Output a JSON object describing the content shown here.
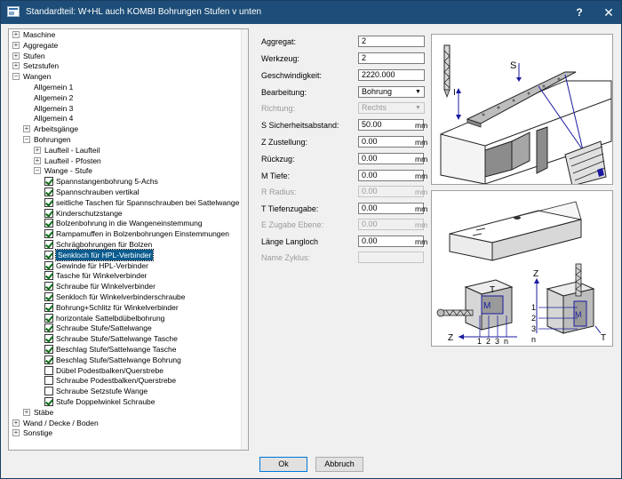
{
  "window": {
    "title": "Standardteil: W+HL auch KOMBI Bohrungen Stufen v unten",
    "help_label": "?",
    "close_label": "✕"
  },
  "tree": {
    "items": [
      {
        "label": "Maschine",
        "state": "collapsed"
      },
      {
        "label": "Aggregate",
        "state": "collapsed"
      },
      {
        "label": "Stufen",
        "state": "collapsed"
      },
      {
        "label": "Setzstufen",
        "state": "collapsed"
      },
      {
        "label": "Wangen",
        "state": "expanded"
      },
      {
        "label": "Allgemein  1"
      },
      {
        "label": "Allgemein  2"
      },
      {
        "label": "Allgemein  3"
      },
      {
        "label": "Allgemein  4"
      },
      {
        "label": "Arbeitsgänge",
        "state": "collapsed"
      },
      {
        "label": "Bohrungen",
        "state": "expanded"
      },
      {
        "label": "Laufteil - Laufteil",
        "state": "collapsed"
      },
      {
        "label": "Laufteil - Pfosten",
        "state": "collapsed"
      },
      {
        "label": "Wange - Stufe",
        "state": "expanded"
      },
      {
        "label": "Spannstangenbohrung 5-Achs",
        "checked": true
      },
      {
        "label": "Spannschrauben vertikal",
        "checked": true
      },
      {
        "label": "seitliche Taschen für Spannschrauben bei Sattelwange",
        "checked": true
      },
      {
        "label": "Kinderschutzstange",
        "checked": true
      },
      {
        "label": "Bolzenbohrung in die Wangeneinstemmung",
        "checked": true
      },
      {
        "label": "Rampamuffen in Bolzenbohrungen Einstemmungen",
        "checked": true
      },
      {
        "label": "Schrägbohrungen für Bolzen",
        "checked": true
      },
      {
        "label": "Senkloch für HPL-Verbinder",
        "checked": true,
        "selected": true
      },
      {
        "label": "Gewinde für HPL-Verbinder",
        "checked": true
      },
      {
        "label": "Tasche für Winkelverbinder",
        "checked": true
      },
      {
        "label": "Schraube für Winkelverbinder",
        "checked": true
      },
      {
        "label": "Senkloch für Winkelverbinderschraube",
        "checked": true
      },
      {
        "label": "Bohrung+Schlitz für Winkelverbinder",
        "checked": true
      },
      {
        "label": "horizontale Sattelbdübelbohrung",
        "checked": true
      },
      {
        "label": "Schraube Stufe/Sattelwange",
        "checked": true
      },
      {
        "label": "Schraube Stufe/Sattelwange Tasche",
        "checked": true
      },
      {
        "label": "Beschlag Stufe/Sattelwange Tasche",
        "checked": true
      },
      {
        "label": "Beschlag Stufe/Sattelwange Bohrung",
        "checked": true
      },
      {
        "label": "Dübel Podestbalken/Querstrebe",
        "checked": false
      },
      {
        "label": "Schraube Podestbalken/Querstrebe",
        "checked": false
      },
      {
        "label": "Schraube Setzstufe Wange",
        "checked": false
      },
      {
        "label": "Stufe Doppelwinkel Schraube",
        "checked": true
      },
      {
        "label": "Stäbe",
        "state": "collapsed"
      },
      {
        "label": "Wand / Decke / Boden",
        "state": "collapsed"
      },
      {
        "label": "Sonstige",
        "state": "collapsed"
      }
    ]
  },
  "form": {
    "aggregat": {
      "label": "Aggregat:",
      "value": "2"
    },
    "werkzeug": {
      "label": "Werkzeug:",
      "value": "2"
    },
    "geschwindigkeit": {
      "label": "Geschwindigkeit:",
      "value": "2220.000"
    },
    "bearbeitung": {
      "label": "Bearbeitung:",
      "value": "Bohrung"
    },
    "richtung": {
      "label": "Richtung:",
      "value": "Rechts"
    },
    "sicherheitsabstand": {
      "label": "S  Sicherheitsabstand:",
      "value": "50.00",
      "unit": "mm"
    },
    "zustellung": {
      "label": "Z  Zustellung:",
      "value": "0.00",
      "unit": "mm"
    },
    "rueckzug": {
      "label": "Rückzug:",
      "value": "0.00",
      "unit": "mm"
    },
    "tiefe": {
      "label": "M  Tiefe:",
      "value": "0.00",
      "unit": "mm"
    },
    "radius": {
      "label": "R  Radius:",
      "value": "0.00",
      "unit": "mm"
    },
    "tiefenzugabe": {
      "label": "T  Tiefenzugabe:",
      "value": "0.00",
      "unit": "mm"
    },
    "zugabe_ebene": {
      "label": "E  Zugabe Ebene:",
      "value": "0.00",
      "unit": "mm"
    },
    "laenge_langloch": {
      "label": "Länge Langloch",
      "value": "0.00",
      "unit": "mm"
    },
    "name_zyklus": {
      "label": "Name Zyklus:",
      "value": ""
    }
  },
  "diagram_top": {
    "labels": {
      "s": "S",
      "i": "I"
    }
  },
  "diagram_bottom": {
    "labels": {
      "z_left": "Z",
      "t_left": "T",
      "m_left": "M",
      "n1": "1",
      "n2": "2",
      "n3": "3",
      "nn": "n",
      "z_right": "Z",
      "t_right": "T",
      "m_right": "M",
      "r1": "1",
      "r2": "2",
      "r3": "3",
      "rn": "n"
    }
  },
  "buttons": {
    "ok": "Ok",
    "abbruch": "Abbruch"
  },
  "colors": {
    "titlebar": "#1d4d78",
    "selection": "#0b5c8f",
    "diagram_blue": "#1a1aa0",
    "checkmark": "#0c6c18"
  }
}
